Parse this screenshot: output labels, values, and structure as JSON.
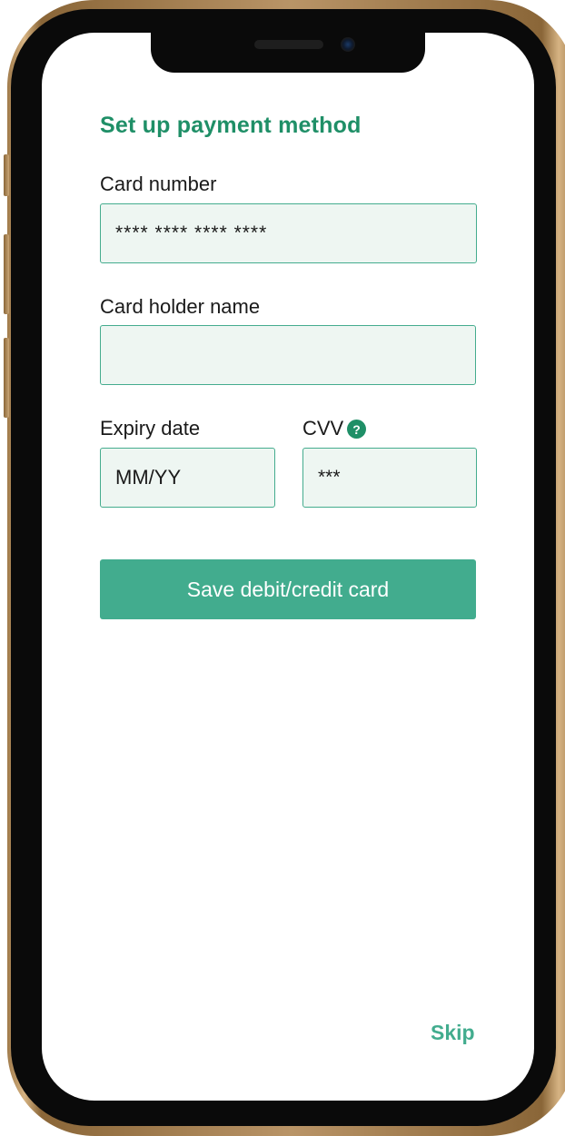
{
  "screen": {
    "title": "Set up payment method"
  },
  "form": {
    "card_number": {
      "label": "Card number",
      "placeholder": "**** **** **** ****"
    },
    "card_holder": {
      "label": "Card holder name",
      "placeholder": ""
    },
    "expiry": {
      "label": "Expiry date",
      "placeholder": "MM/YY"
    },
    "cvv": {
      "label": "CVV",
      "placeholder": "***",
      "help_icon": "?"
    }
  },
  "actions": {
    "save_label": "Save debit/credit card",
    "skip_label": "Skip"
  },
  "colors": {
    "accent": "#1f8f67",
    "button": "#42ac8e",
    "field_bg": "#eef6f2",
    "field_border": "#44ac8e"
  }
}
